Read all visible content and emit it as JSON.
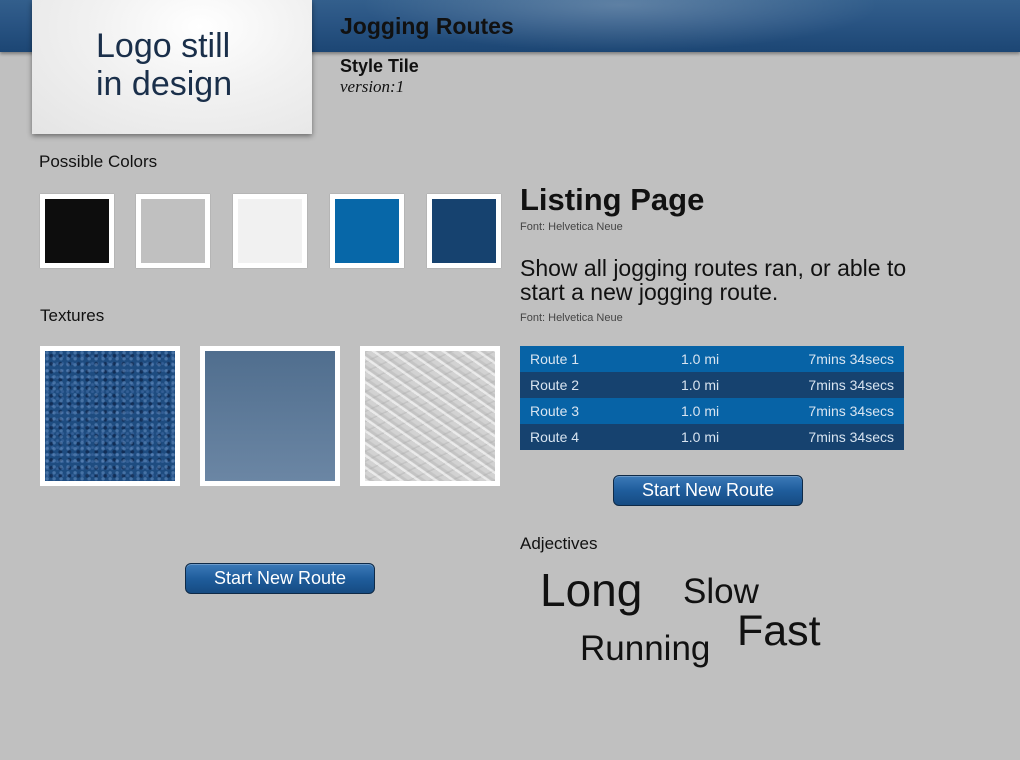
{
  "header": {
    "title": "Jogging Routes"
  },
  "logo": {
    "line1": "Logo still",
    "line2": "in design"
  },
  "tile": {
    "name": "Style Tile",
    "version": "version:1"
  },
  "colors": {
    "label": "Possible Colors",
    "swatches": [
      "#0d0d0d",
      "#c0c0c0",
      "#f1f1f1",
      "#0767a8",
      "#16426f"
    ]
  },
  "textures": {
    "label": "Textures"
  },
  "buttons": {
    "start_new_route": "Start New Route",
    "start_new_route_left": "Start New Route"
  },
  "listing": {
    "title": "Listing Page",
    "title_font": "Font: Helvetica Neue",
    "description": "Show all jogging routes ran, or able to start a new jogging route.",
    "description_font": "Font: Helvetica Neue",
    "routes": [
      {
        "name": "Route 1",
        "distance": "1.0 mi",
        "time": "7mins 34secs"
      },
      {
        "name": "Route 2",
        "distance": "1.0 mi",
        "time": "7mins 34secs"
      },
      {
        "name": "Route 3",
        "distance": "1.0 mi",
        "time": "7mins 34secs"
      },
      {
        "name": "Route 4",
        "distance": "1.0 mi",
        "time": "7mins 34secs"
      }
    ]
  },
  "adjectives": {
    "label": "Adjectives",
    "words": [
      "Long",
      "Slow",
      "Running",
      "Fast"
    ]
  }
}
